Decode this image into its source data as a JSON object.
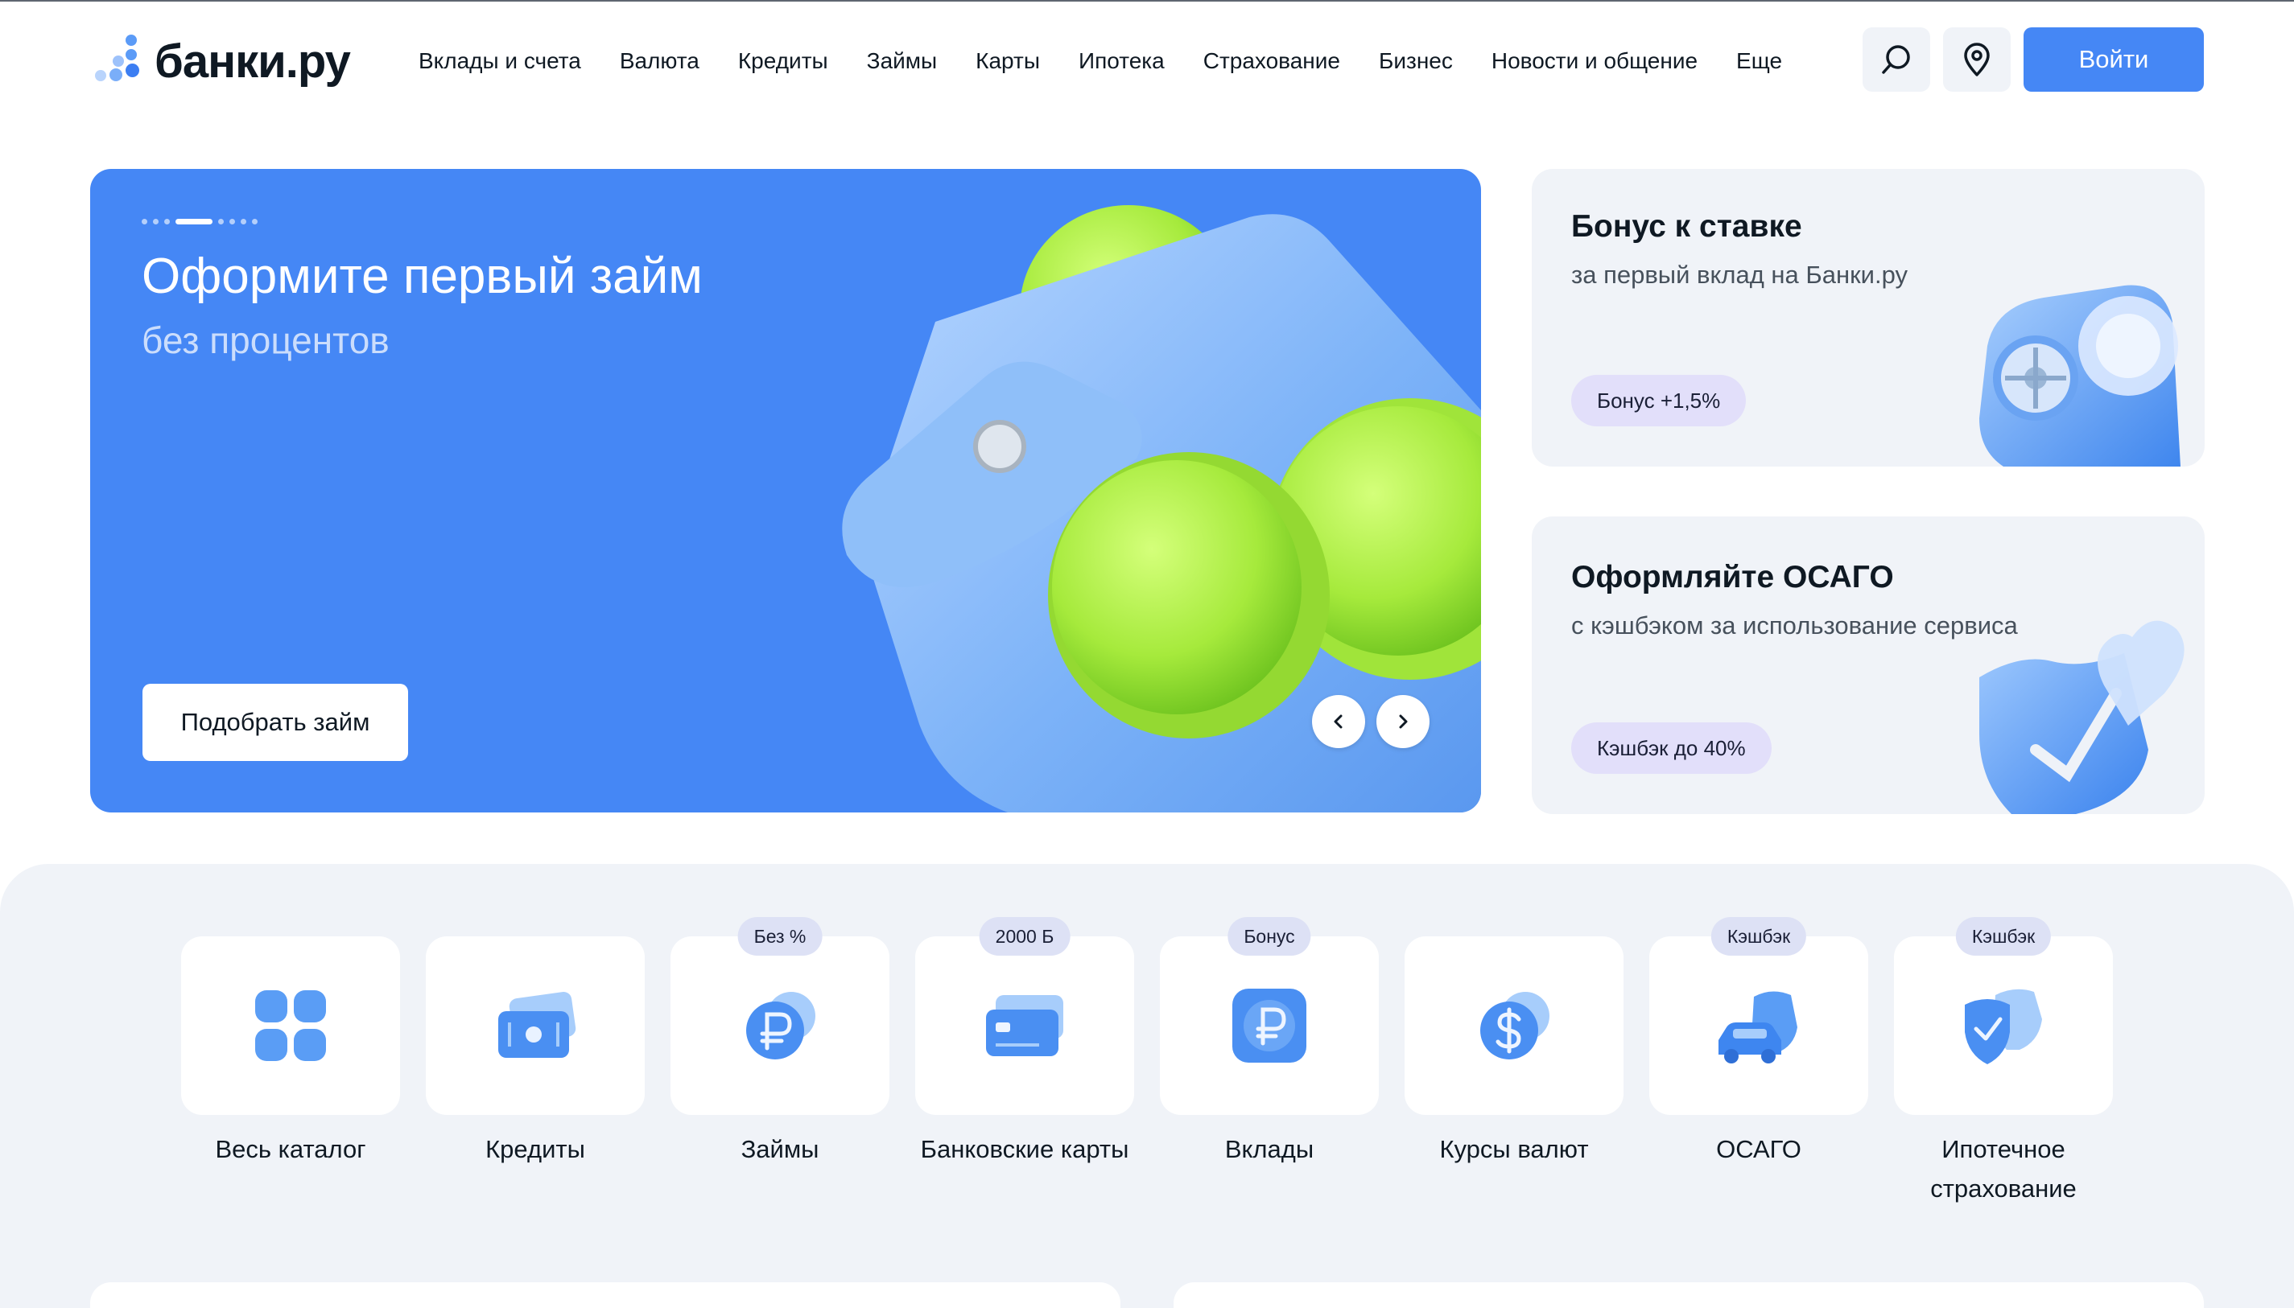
{
  "header": {
    "logo_text": "банки.ру",
    "nav": [
      "Вклады и счета",
      "Валюта",
      "Кредиты",
      "Займы",
      "Карты",
      "Ипотека",
      "Страхование",
      "Бизнес",
      "Новости и общение",
      "Еще"
    ],
    "login_label": "Войти",
    "search_icon": "search-icon",
    "location_icon": "location-pin-icon"
  },
  "hero": {
    "title": "Оформите первый займ",
    "subtitle": "без процентов",
    "button_label": "Подобрать займ",
    "slides_count": 8,
    "active_slide": 4,
    "art": "wallet-with-coins-illustration"
  },
  "promos": [
    {
      "title": "Бонус к ставке",
      "subtitle": "за первый вклад на Банки.ру",
      "badge": "Бонус +1,5%",
      "art": "safe-illustration"
    },
    {
      "title": "Оформляйте ОСАГО",
      "subtitle": "с кэшбэком за использование сервиса",
      "badge": "Кэшбэк до 40%",
      "art": "shield-heart-illustration"
    }
  ],
  "catalog": [
    {
      "label": "Весь каталог",
      "badge": "",
      "icon": "grid-icon"
    },
    {
      "label": "Кредиты",
      "badge": "",
      "icon": "cash-icon"
    },
    {
      "label": "Займы",
      "badge": "Без %",
      "icon": "ruble-coin-icon"
    },
    {
      "label": "Банковские карты",
      "badge": "2000 Б",
      "icon": "bank-card-icon"
    },
    {
      "label": "Вклады",
      "badge": "Бонус",
      "icon": "ruble-square-icon"
    },
    {
      "label": "Курсы валют",
      "badge": "",
      "icon": "dollar-coin-icon"
    },
    {
      "label": "ОСАГО",
      "badge": "Кэшбэк",
      "icon": "car-shield-icon"
    },
    {
      "label": "Ипотечное страхование",
      "badge": "Кэшбэк",
      "icon": "shield-check-icon"
    }
  ],
  "colors": {
    "brand": "#4587f5",
    "surface": "#f0f3f8",
    "badge": "#e2dffa",
    "coin_green": "#a8e83a"
  }
}
